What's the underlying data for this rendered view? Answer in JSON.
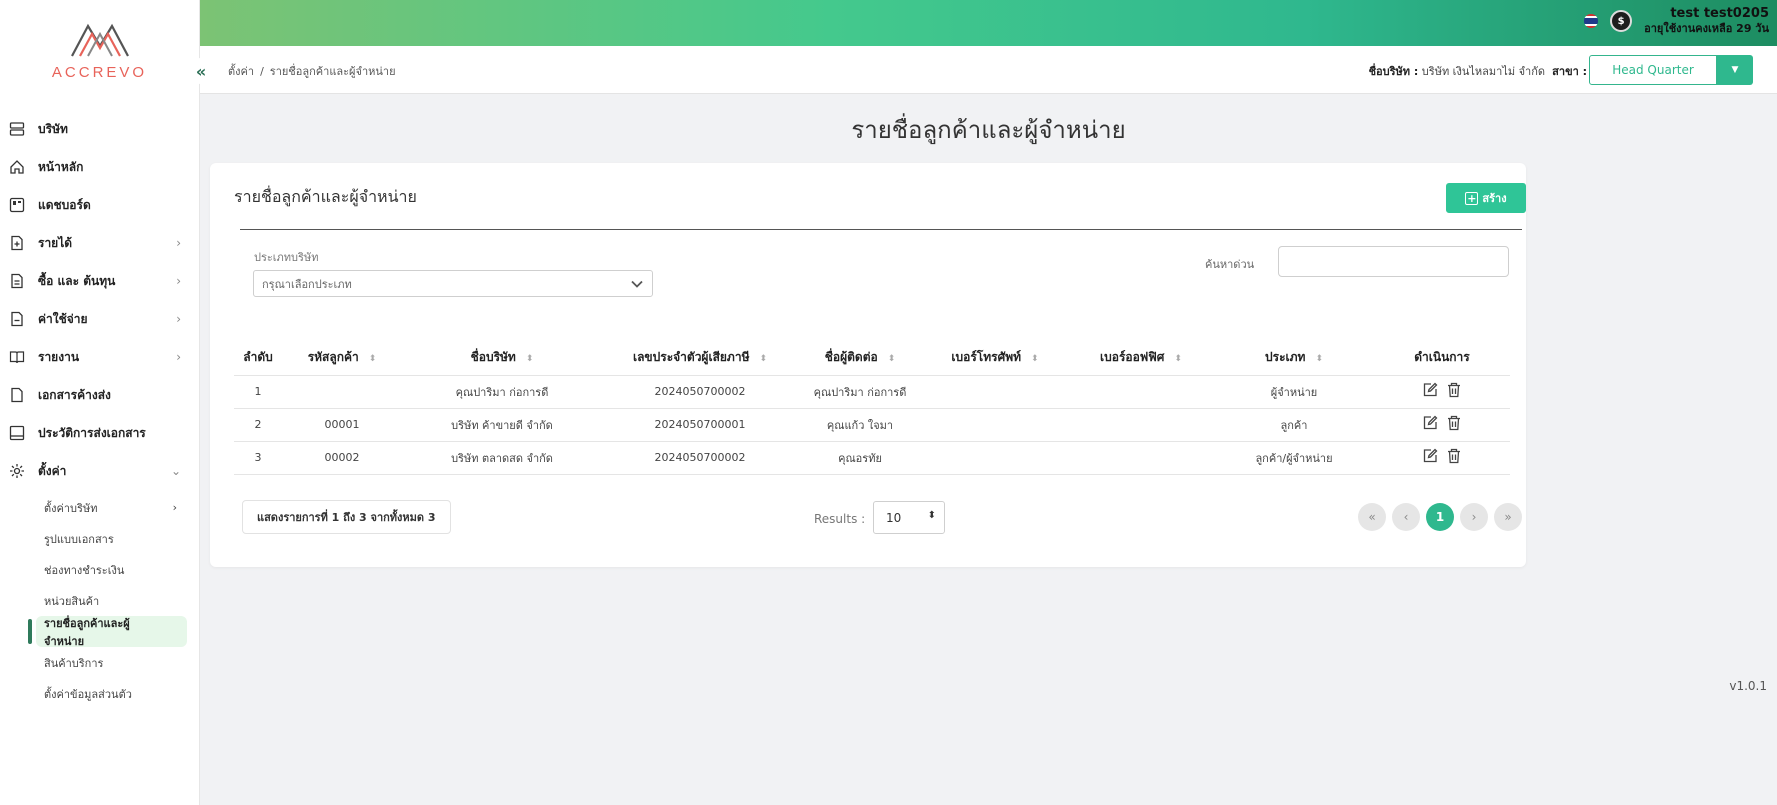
{
  "brand": {
    "name": "ACCREVO",
    "color": "#e8635a"
  },
  "header": {
    "user_name": "test test0205",
    "user_sub": "อายุใช้งานคงเหลือ 29 วัน",
    "coin_icon": "dollar-coin-icon",
    "flag_icon": "thai-flag-icon"
  },
  "crumb": {
    "collapse_glyph": "«",
    "items": [
      "ตั้งค่า",
      "รายชื่อลูกค้าและผู้จำหน่าย"
    ],
    "sep": "/",
    "company_label": "ชื่อบริษัท :",
    "company_value": "บริษัท เงินไหลมาไม่ จำกัด",
    "branch_label": "สาขา :",
    "branch_value": "Head Quarter",
    "branch_caret": "▼"
  },
  "sidebar": {
    "items": [
      {
        "label": "บริษัท",
        "icon": "server-icon",
        "chev": ""
      },
      {
        "label": "หน้าหลัก",
        "icon": "home-icon",
        "chev": ""
      },
      {
        "label": "แดชบอร์ด",
        "icon": "dashboard-icon",
        "chev": ""
      },
      {
        "label": "รายได้",
        "icon": "file-plus-icon",
        "chev": "›"
      },
      {
        "label": "ซื้อ และ ต้นทุน",
        "icon": "file-text-icon",
        "chev": "›"
      },
      {
        "label": "ค่าใช้จ่าย",
        "icon": "file-minus-icon",
        "chev": "›"
      },
      {
        "label": "รายงาน",
        "icon": "book-icon",
        "chev": "›"
      },
      {
        "label": "เอกสารค้างส่ง",
        "icon": "file-icon",
        "chev": ""
      },
      {
        "label": "ประวัติการส่งเอกสาร",
        "icon": "tray-icon",
        "chev": ""
      },
      {
        "label": "ตั้งค่า",
        "icon": "gear-icon",
        "chev": "⌄"
      }
    ],
    "sub_items": [
      {
        "label": "ตั้งค่าบริษัท",
        "chev": "›"
      },
      {
        "label": "รูปแบบเอกสาร",
        "chev": ""
      },
      {
        "label": "ช่องทางชำระเงิน",
        "chev": ""
      },
      {
        "label": "หน่วยสินค้า",
        "chev": ""
      },
      {
        "label": "รายชื่อลูกค้าและผู้จำหน่าย",
        "chev": ""
      },
      {
        "label": "สินค้าบริการ",
        "chev": ""
      },
      {
        "label": "ตั้งค่าข้อมูลส่วนตัว",
        "chev": ""
      }
    ]
  },
  "main": {
    "title": "รายชื่อลูกค้าและผู้จำหน่าย",
    "card_title": "รายชื่อลูกค้าและผู้จำหน่าย",
    "create_label": "สร้าง",
    "create_glyph": "+",
    "filter_label": "ประเภทบริษัท",
    "filter_placeholder": "กรุณาเลือกประเภท",
    "search_label": "ค้นหาด่วน",
    "search_value": ""
  },
  "table": {
    "headers": [
      "ลำดับ",
      "รหัสลูกค้า",
      "ชื่อบริษัท",
      "เลขประจำตัวผู้เสียภาษี",
      "ชื่อผู้ติดต่อ",
      "เบอร์โทรศัพท์",
      "เบอร์ออฟฟิศ",
      "ประเภท",
      "ดำเนินการ"
    ],
    "sort_glyph": "⬍",
    "rows": [
      {
        "no": "1",
        "code": "",
        "company": "คุณปาริมา ก่อการดี",
        "tax": "2024050700002",
        "contact": "คุณปาริมา ก่อการดี",
        "phone": "",
        "office": "",
        "type": "ผู้จำหน่าย"
      },
      {
        "no": "2",
        "code": "00001",
        "company": "บริษัท ค้าขายดี จำกัด",
        "tax": "2024050700001",
        "contact": "คุณแก้ว ใจมา",
        "phone": "",
        "office": "",
        "type": "ลูกค้า"
      },
      {
        "no": "3",
        "code": "00002",
        "company": "บริษัท ตลาดสด จำกัด",
        "tax": "2024050700002",
        "contact": "คุณอรทัย",
        "phone": "",
        "office": "",
        "type": "ลูกค้า/ผู้จำหน่าย"
      }
    ]
  },
  "footer": {
    "showing": "แสดงรายการที่ 1 ถึง 3 จากทั้งหมด 3",
    "results_label": "Results :",
    "results_value": "10",
    "results_caret": "⬍",
    "pager": [
      "«",
      "‹",
      "1",
      "›",
      "»"
    ],
    "version": "v1.0.1"
  },
  "colors": {
    "accent": "#2fb88e",
    "active_bg": "#e6f7e9",
    "active_bar": "#2f7a5b"
  }
}
